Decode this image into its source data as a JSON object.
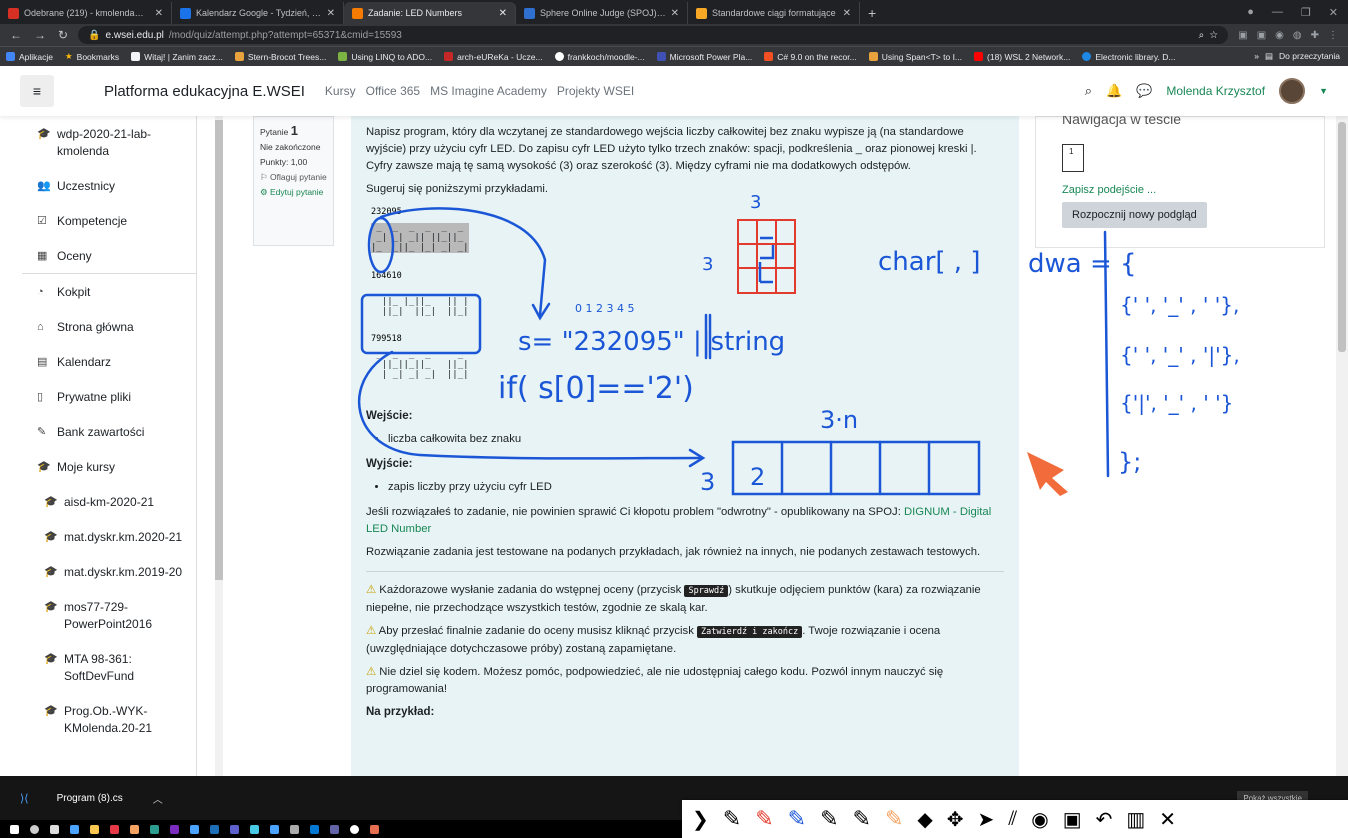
{
  "browser": {
    "tabs": [
      {
        "label": "Odebrane (219) - kmolenda@gm",
        "color": "#d93025",
        "active": false
      },
      {
        "label": "Kalendarz Google - Tydzień, w kt",
        "color": "#1a73e8",
        "active": false
      },
      {
        "label": "Zadanie: LED Numbers",
        "color": "#f57c00",
        "active": true
      },
      {
        "label": "Sphere Online Judge (SPOJ) - Str",
        "color": "#2f6fcf",
        "active": false
      },
      {
        "label": "Standardowe ciągi formatujące",
        "color": "#f9a825",
        "active": false
      }
    ],
    "url_domain": "e.wsei.edu.pl",
    "url_path": "/mod/quiz/attempt.php?attempt=65371&cmid=15593",
    "bookmarks": [
      "Aplikacje",
      "Bookmarks",
      "Witaj! | Zanim zacz...",
      "Stern-Brocot Trees...",
      "Using LINQ to ADO...",
      "arch-eUReKa - Ucze...",
      "frankkoch/moodle-...",
      "Microsoft Power Pla...",
      "C# 9.0 on the recor...",
      "Using Span<T> to I...",
      "(18) WSL 2 Network...",
      "Electronic library. D..."
    ],
    "bookmarks_end": "Do przeczytania"
  },
  "header": {
    "brand": "Platforma edukacyjna E.WSEI",
    "nav": [
      "Kursy",
      "Office 365",
      "MS Imagine Academy",
      "Projekty WSEI"
    ],
    "user": "Molenda Krzysztof"
  },
  "drawer": {
    "items": [
      {
        "label": "wdp-2020-21-lab-kmolenda",
        "icon": "graduation-cap-icon",
        "glyph": "🎓"
      },
      {
        "label": "Uczestnicy",
        "icon": "users-icon",
        "glyph": "👥"
      },
      {
        "label": "Kompetencje",
        "icon": "check-square-icon",
        "glyph": "☑"
      },
      {
        "label": "Oceny",
        "icon": "table-icon",
        "glyph": "▦"
      },
      {
        "label": "Kokpit",
        "icon": "dashboard-icon",
        "glyph": "◔"
      },
      {
        "label": "Strona główna",
        "icon": "home-icon",
        "glyph": "⌂"
      },
      {
        "label": "Kalendarz",
        "icon": "calendar-icon",
        "glyph": "▤"
      },
      {
        "label": "Prywatne pliki",
        "icon": "file-icon",
        "glyph": "▯"
      },
      {
        "label": "Bank zawartości",
        "icon": "brush-icon",
        "glyph": "✎"
      },
      {
        "label": "Moje kursy",
        "icon": "graduation-cap-icon",
        "glyph": "🎓"
      },
      {
        "label": "aisd-km-2020-21",
        "icon": "graduation-cap-icon",
        "glyph": "🎓"
      },
      {
        "label": "mat.dyskr.km.2020-21",
        "icon": "graduation-cap-icon",
        "glyph": "🎓"
      },
      {
        "label": "mat.dyskr.km.2019-20",
        "icon": "graduation-cap-icon",
        "glyph": "🎓"
      },
      {
        "label": "mos77-729-PowerPoint2016",
        "icon": "graduation-cap-icon",
        "glyph": "🎓"
      },
      {
        "label": "MTA 98-361: SoftDevFund",
        "icon": "graduation-cap-icon",
        "glyph": "🎓"
      },
      {
        "label": "Prog.Ob.-WYK-KMolenda.20-21",
        "icon": "graduation-cap-icon",
        "glyph": "🎓"
      }
    ]
  },
  "question_info": {
    "label": "Pytanie",
    "number": "1",
    "status": "Nie zakończone",
    "points": "Punkty: 1,00",
    "flag": "Oflaguj pytanie",
    "edit": "Edytuj pytanie"
  },
  "question": {
    "intro": "Napisz program, który dla wczytanej ze standardowego wejścia liczby całkowitej bez znaku wypisze ją (na standardowe wyjście) przy użyciu cyfr LED. Do zapisu cyfr LED użyto tylko trzech znaków: spacji, podkreślenia _ oraz pionowej kreski |. Cyfry zawsze mają tę samą wysokość (3) oraz szerokość (3). Między cyframi nie ma dodatkowych odstępów.",
    "hint": "Sugeruj się poniższymi przykładami.",
    "examples": [
      {
        "input": "232095",
        "led": " _  _  _  _  _  _ \n _| _| _|| ||_||_ \n|_  _||_ |_| _| _|"
      },
      {
        "input": "164610",
        "led": "    _     _       _ \n  ||_ |_||_   || |\n  ||_|  ||_|  ||_|"
      },
      {
        "input": "799518",
        "led": " _  _  _  _     _ \n  ||_||_||_   ||_|\n  | _| _| _|  ||_|"
      }
    ],
    "input_title": "Wejście:",
    "input_item": "liczba całkowita bez znaku",
    "output_title": "Wyjście:",
    "output_item": "zapis liczby przy użyciu cyfr LED",
    "spoj_text": "Jeśli rozwiązałeś to zadanie, nie powinien sprawić Ci kłopotu problem \"odwrotny\" - opublikowany na SPOJ: ",
    "spoj_link": "DIGNUM - Digital LED Number",
    "tested": "Rozwiązanie zadania jest testowane na podanych przykładach, jak również na innych, nie podanych zestawach testowych.",
    "warn1_a": "Każdorazowe wysłanie zadania do wstępnej oceny (przycisk ",
    "warn1_kbd": "Sprawdź",
    "warn1_b": ") skutkuje odjęciem punktów (kara) za rozwiązanie niepełne, nie przechodzące wszystkich testów, zgodnie ze skalą kar.",
    "warn2_a": "Aby przesłać finalnie zadanie do oceny musisz kliknąć przycisk ",
    "warn2_kbd": "Zatwierdź i zakończ",
    "warn2_b": ". Twoje rozwiązanie i ocena (uwzględniające dotychczasowe próby) zostaną zapamiętane.",
    "warn3": "Nie dziel się kodem. Możesz pomóc, podpowiedzieć, ale nie udostępniaj całego kodu. Pozwól innym nauczyć się programowania!",
    "example_title": "Na przykład:"
  },
  "quiz_nav": {
    "title": "Nawigacja w teście",
    "box": "1",
    "save": "Zapisz podejście ...",
    "preview": "Rozpocznij nowy podgląd"
  },
  "taskbar": {
    "app": "Program (8).cs",
    "show_all": "Pokaż wszystkie"
  },
  "ink": {
    "s_assign": "s= \"232095\" ||string",
    "if_line": "if( s[0]=='2')",
    "char": "char[ , ]",
    "dwa": "dwa = {",
    "row1": "{' ', '_' , ' '},",
    "row2": "{' ', '_' , '|'},",
    "row3": "{'|', '_' , ' '}",
    "close": "};",
    "three": "3",
    "three_n": "3·n",
    "idx": "0 1 2 3 4 5",
    "cell": "2"
  },
  "colors": {
    "accent": "#198754",
    "ink_blue": "#1a56d6",
    "ink_red": "#e23b2e",
    "cursor": "#f26b3a"
  }
}
